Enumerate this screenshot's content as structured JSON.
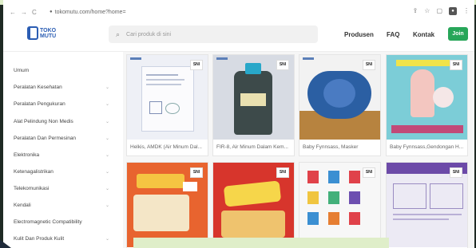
{
  "browser": {
    "url": "tokomutu.com/home?home=",
    "nav": [
      "←",
      "→",
      "C"
    ]
  },
  "header": {
    "logo_line1": "TOKO",
    "logo_line2": "MUTU",
    "search_placeholder": "Cari produk di sini",
    "menu": [
      "Produsen",
      "FAQ",
      "Kontak"
    ],
    "join_label": "Join"
  },
  "sidebar": {
    "items": [
      {
        "label": "Umum",
        "chevron": false
      },
      {
        "label": "Peralatan Kesehatan",
        "chevron": true
      },
      {
        "label": "Peralatan Pengukuran",
        "chevron": true
      },
      {
        "label": "Alat Pelindung Non Medis",
        "chevron": true
      },
      {
        "label": "Peralatan Dan Permesinan",
        "chevron": true
      },
      {
        "label": "Elektronika",
        "chevron": true
      },
      {
        "label": "Ketenagalistrikan",
        "chevron": true
      },
      {
        "label": "Telekomunikasi",
        "chevron": true
      },
      {
        "label": "Kendali",
        "chevron": true
      },
      {
        "label": "Electromagnetic Compatibility",
        "chevron": false
      },
      {
        "label": "Kulit Dan Produk Kulit",
        "chevron": true
      }
    ]
  },
  "products": [
    {
      "name": "Helkis, AMDK (Air Minum Dal...",
      "badge": "SNI"
    },
    {
      "name": "FIR-8, Air Minum Dalam Kem...",
      "badge": "SNI"
    },
    {
      "name": "Baby Fynnsass, Masker",
      "badge": "SNI"
    },
    {
      "name": "Baby Fynnsass,Gendongan H...",
      "badge": "SNI"
    },
    {
      "name": "",
      "badge": "SNI"
    },
    {
      "name": "",
      "badge": "SNI"
    },
    {
      "name": "",
      "badge": "SNI"
    },
    {
      "name": "",
      "badge": "SNI"
    }
  ],
  "colors": {
    "brand": "#2b5db3",
    "join": "#27a659"
  }
}
